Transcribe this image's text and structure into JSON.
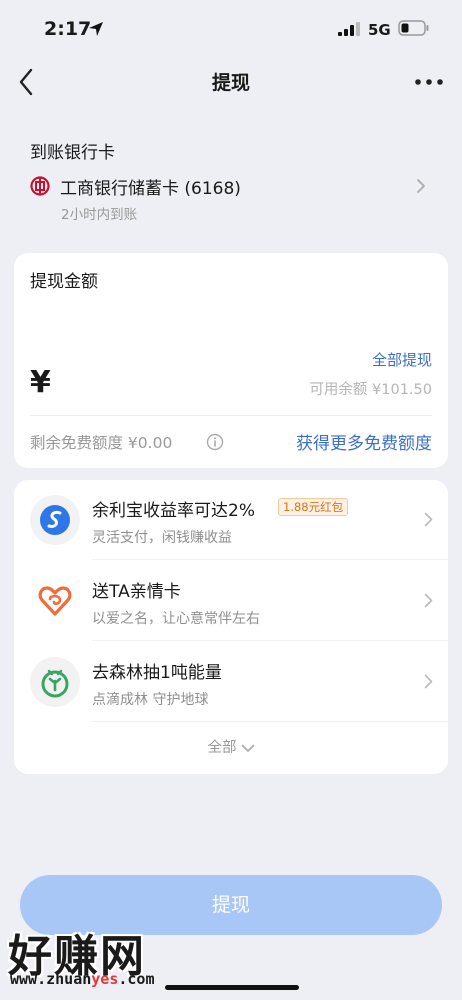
{
  "status_bar": {
    "time": "2:17",
    "network": "5G"
  },
  "nav": {
    "title": "提现"
  },
  "bank": {
    "heading": "到账银行卡",
    "name": "工商银行储蓄卡 (6168)",
    "arrival_time": "2小时内到账"
  },
  "amount": {
    "label": "提现金额",
    "currency_symbol": "¥",
    "withdraw_all": "全部提现",
    "available": "可用余额 ¥101.50",
    "free_quota": "剩余免费额度 ¥0.00",
    "get_more_free": "获得更多免费额度"
  },
  "promos": [
    {
      "title": "余利宝收益率可达2%",
      "badge": "1.88元红包",
      "subtitle": "灵活支付，闲钱赚收益",
      "icon": "yulibao-icon"
    },
    {
      "title": "送TA亲情卡",
      "subtitle": "以爱之名，让心意常伴左右",
      "icon": "family-card-icon"
    },
    {
      "title": "去森林抽1吨能量",
      "subtitle": "点滴成林 守护地球",
      "icon": "forest-icon"
    }
  ],
  "show_all": "全部",
  "submit_label": "提现",
  "watermark": {
    "title": "好赚网",
    "url_prefix": "www.zhuan",
    "url_highlight": "yes",
    "url_suffix": ".com"
  },
  "colors": {
    "accent": "#3c6fc9",
    "button": "#a8c6f6",
    "background": "#eeeff5",
    "bank_red": "#c8102e"
  }
}
